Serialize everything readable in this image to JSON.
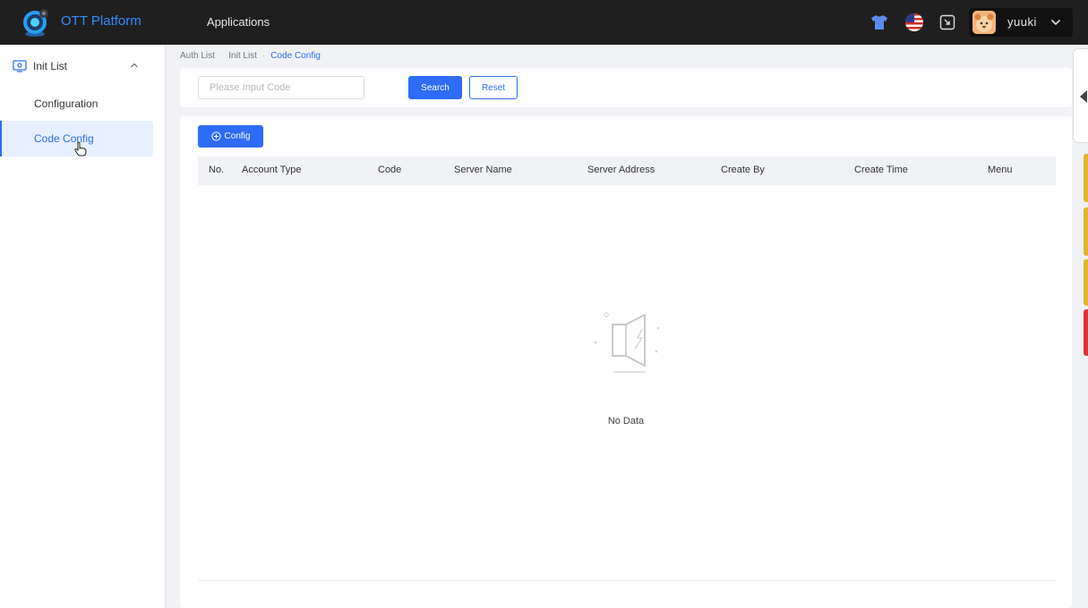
{
  "header": {
    "brand": "OTT Platform",
    "nav_applications": "Applications",
    "username": "yuuki",
    "icons": [
      "shirt-icon",
      "us-flag-icon",
      "exit-fullscreen-icon",
      "avatar",
      "chevron-down-icon"
    ]
  },
  "sidebar": {
    "group_label": "Init List",
    "items": [
      {
        "label": "Configuration",
        "active": false
      },
      {
        "label": "Code Config",
        "active": true
      }
    ]
  },
  "breadcrumb": {
    "items": [
      "Auth List",
      "Init List",
      "Code Config"
    ],
    "separator": "·"
  },
  "search": {
    "placeholder": "Please Input Code",
    "value": "",
    "search_label": "Search",
    "reset_label": "Reset"
  },
  "table": {
    "config_button": "Config",
    "columns": [
      "No.",
      "Account Type",
      "Code",
      "Server Name",
      "Server Address",
      "Create By",
      "Create Time",
      "Menu"
    ],
    "rows": [],
    "empty_text": "No Data"
  },
  "colors": {
    "header_bg": "#1f1f1f",
    "brand": "#2f8cff",
    "primary": "#2d6cf6",
    "active_bg": "#e6efff",
    "strip_yellow": "#e2b530",
    "strip_red": "#d9363e"
  }
}
